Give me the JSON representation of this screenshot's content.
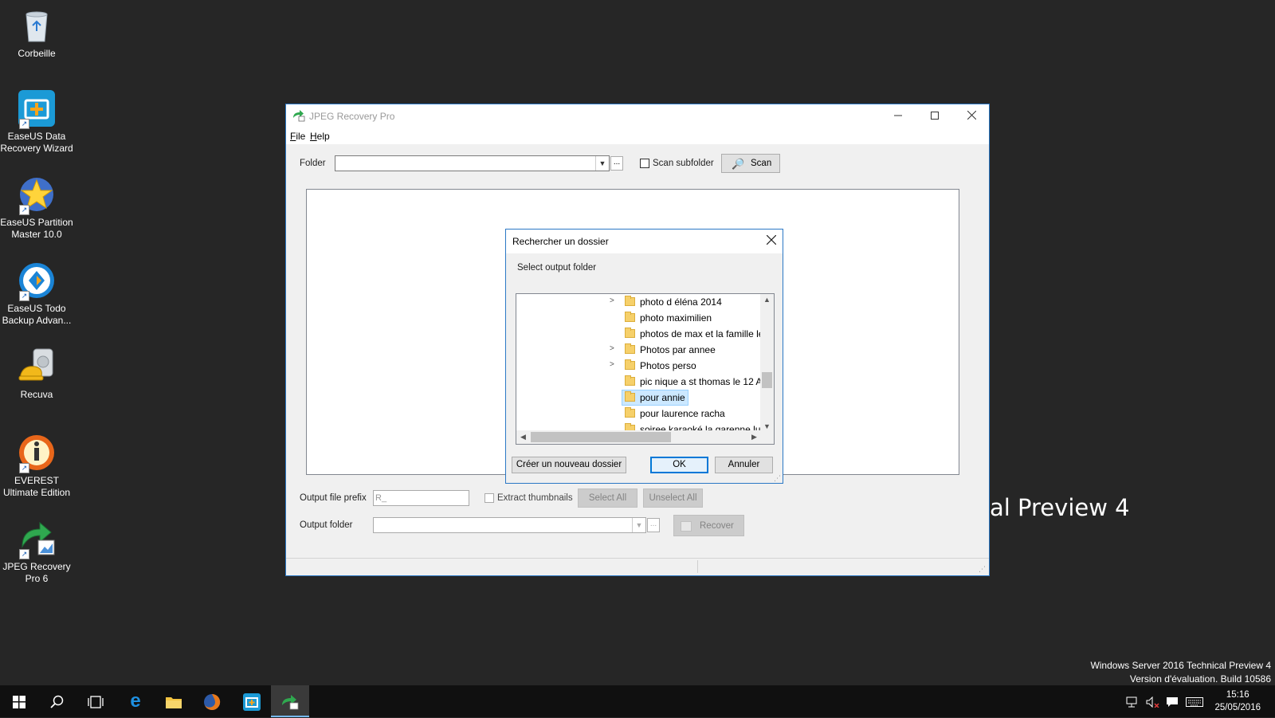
{
  "desktop": {
    "icons": [
      {
        "label": "Corbeille"
      },
      {
        "label": "EaseUS Data Recovery Wizard"
      },
      {
        "label": "EaseUS Partition Master 10.0"
      },
      {
        "label": "EaseUS Todo Backup Advan..."
      },
      {
        "label": "Recuva"
      },
      {
        "label": "EVEREST Ultimate Edition"
      },
      {
        "label": "JPEG Recovery Pro 6"
      }
    ],
    "watermark_big": "al Preview 4",
    "watermark_line1": "Windows Server 2016 Technical Preview 4",
    "watermark_line2": "Version d'évaluation. Build 10586"
  },
  "app": {
    "title": "JPEG Recovery Pro",
    "menu": {
      "file": "File",
      "help": "Help"
    },
    "folder_label": "Folder",
    "folder_value": "",
    "browse_label": "...",
    "scan_subfolder_label": "Scan subfolder",
    "scan_button": "Scan",
    "output_prefix_label": "Output file prefix",
    "output_prefix_value": "R_",
    "extract_thumbnails_label": "Extract thumbnails",
    "select_all": "Select All",
    "unselect_all": "Unselect All",
    "output_folder_label": "Output folder",
    "output_folder_value": "",
    "recover_button": "Recover"
  },
  "dialog": {
    "title": "Rechercher un dossier",
    "instruction": "Select output folder",
    "items": [
      {
        "name": "photo d éléna 2014",
        "expandable": true,
        "selected": false
      },
      {
        "name": "photo maximilien",
        "expandable": false,
        "selected": false
      },
      {
        "name": "photos de max et la famille le",
        "expandable": false,
        "selected": false
      },
      {
        "name": "Photos par annee",
        "expandable": true,
        "selected": false
      },
      {
        "name": "Photos perso",
        "expandable": true,
        "selected": false
      },
      {
        "name": "pic nique a st thomas le 12 A",
        "expandable": false,
        "selected": false
      },
      {
        "name": "pour annie",
        "expandable": false,
        "selected": true
      },
      {
        "name": "pour laurence racha",
        "expandable": false,
        "selected": false
      },
      {
        "name": "soiree karaoké la garenne lun",
        "expandable": false,
        "selected": false
      }
    ],
    "new_folder_button": "Créer un nouveau dossier",
    "ok_button": "OK",
    "cancel_button": "Annuler"
  },
  "taskbar": {
    "time": "15:16",
    "date": "25/05/2016"
  },
  "colors": {
    "desktop_bg": "#262626",
    "accent": "#0078d7",
    "selection": "#cce8ff"
  }
}
